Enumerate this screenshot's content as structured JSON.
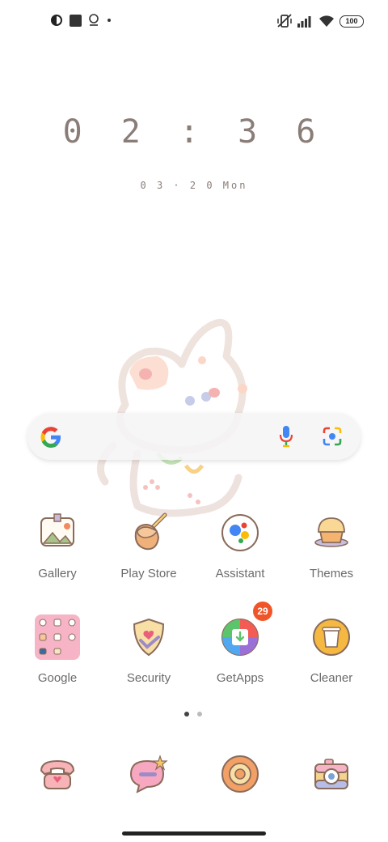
{
  "status_bar": {
    "battery": "100",
    "icons": [
      "circle-half-icon",
      "square-icon",
      "location-pin-icon",
      "dot-icon",
      "vibrate-off-icon",
      "signal-icon",
      "wifi-icon",
      "battery-icon"
    ]
  },
  "clock": {
    "time": "0 2 : 3 6",
    "date": "0 3 · 2 0  Mon"
  },
  "search": {
    "icons": [
      "google-g-icon",
      "mic-icon",
      "lens-icon"
    ]
  },
  "apps": {
    "row1": [
      {
        "label": "Gallery"
      },
      {
        "label": "Play Store"
      },
      {
        "label": "Assistant"
      },
      {
        "label": "Themes"
      }
    ],
    "row2": [
      {
        "label": "Google"
      },
      {
        "label": "Security"
      },
      {
        "label": "GetApps",
        "badge": "29"
      },
      {
        "label": "Cleaner"
      }
    ]
  },
  "pages": {
    "current": 1,
    "total": 2
  },
  "dock": [
    "phone-icon",
    "messages-icon",
    "browser-icon",
    "camera-icon"
  ],
  "colors": {
    "clock": "#8a7d78",
    "badge": "#f0552a",
    "label": "#6b6b6b"
  }
}
